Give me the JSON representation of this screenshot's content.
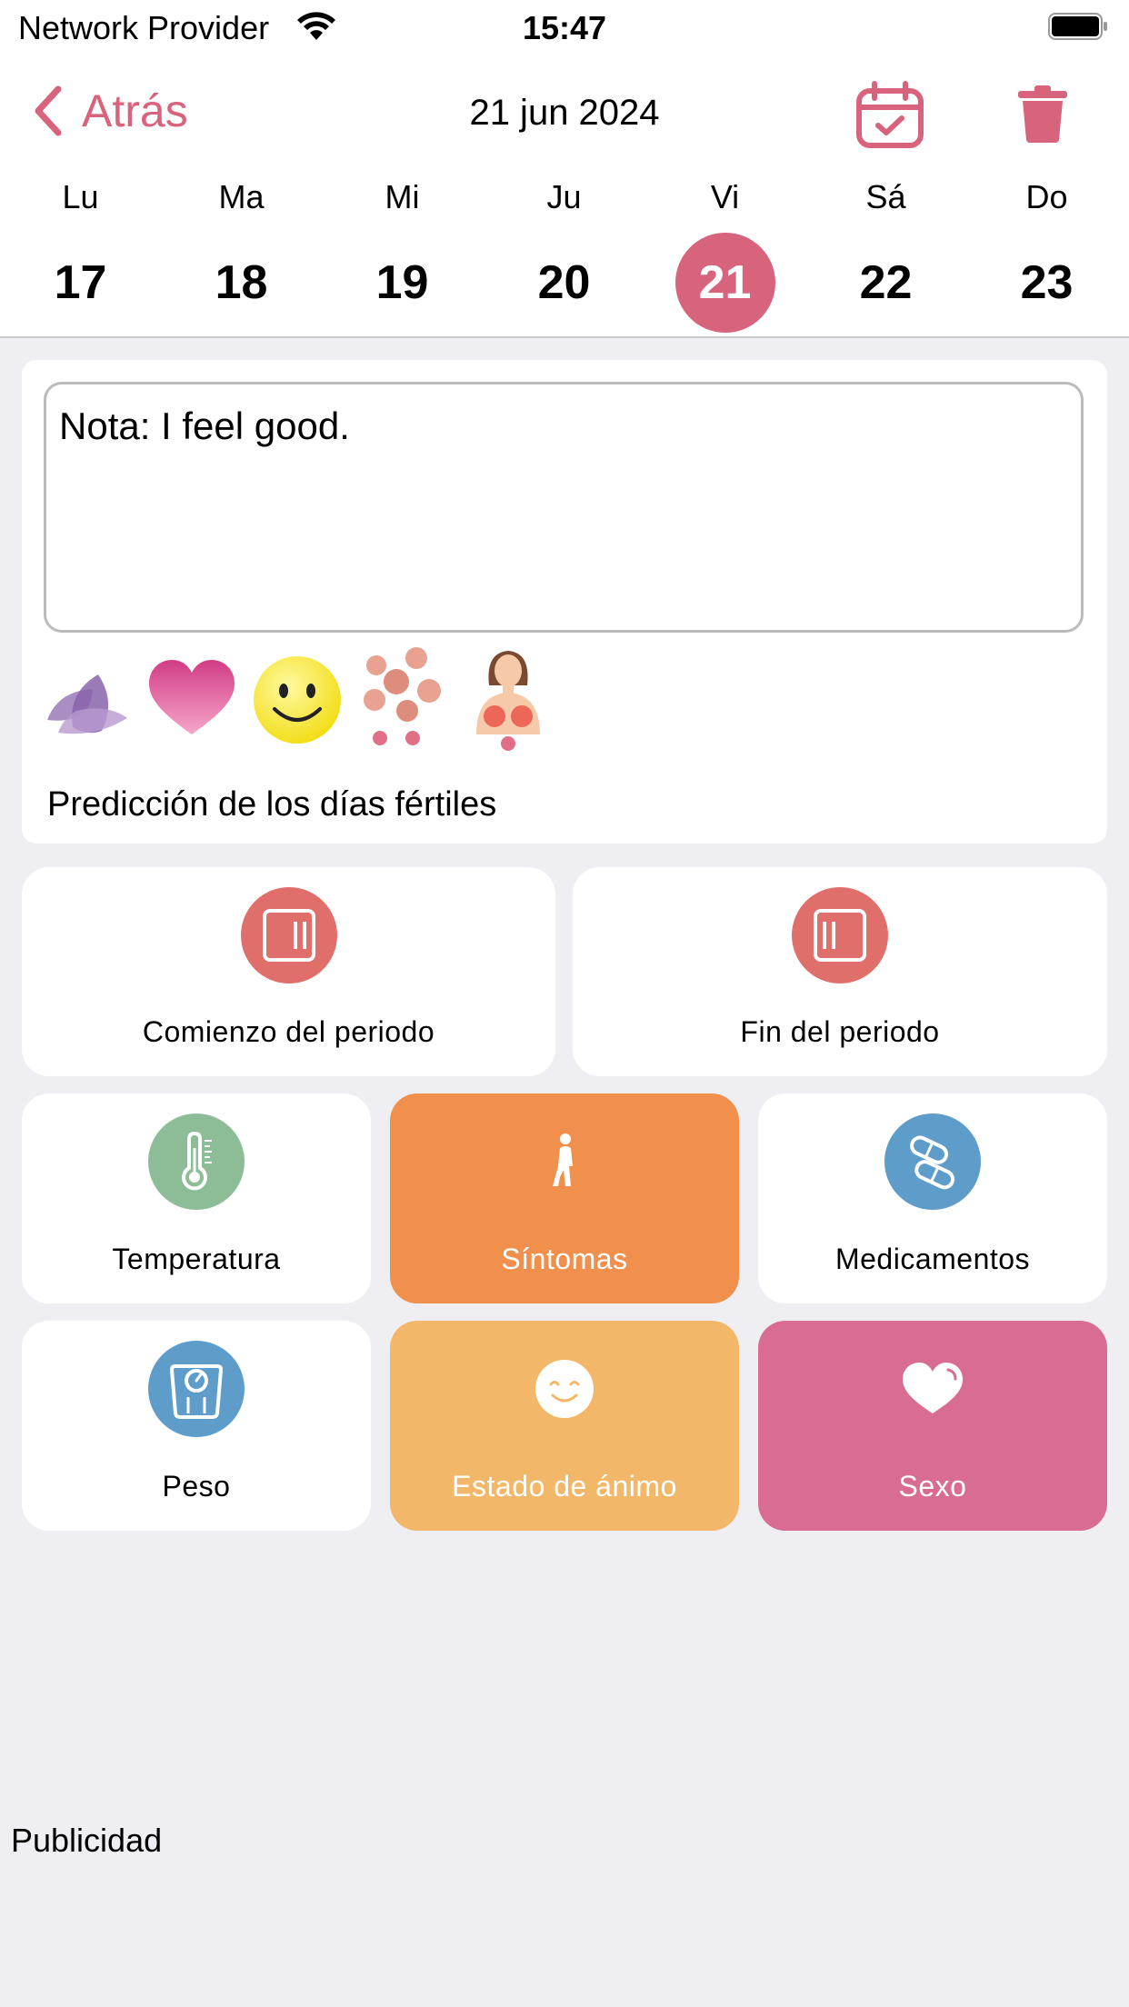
{
  "status_bar": {
    "carrier": "Network Provider",
    "time": "15:47"
  },
  "header": {
    "back_label": "Atrás",
    "date": "21 jun 2024"
  },
  "week": [
    {
      "name": "Lu",
      "num": "17"
    },
    {
      "name": "Ma",
      "num": "18"
    },
    {
      "name": "Mi",
      "num": "19"
    },
    {
      "name": "Ju",
      "num": "20"
    },
    {
      "name": "Vi",
      "num": "21",
      "selected": true
    },
    {
      "name": "Sá",
      "num": "22"
    },
    {
      "name": "Do",
      "num": "23"
    }
  ],
  "note": {
    "text": "Nota: I feel good."
  },
  "entry_icons": [
    "lotus-icon",
    "heart-icon",
    "smiley-icon",
    "acne-icon",
    "breast-pain-icon"
  ],
  "fertile_prediction": "Predicción de los días fértiles",
  "tiles": {
    "period_start": "Comienzo del periodo",
    "period_end": "Fin del periodo",
    "temperature": "Temperatura",
    "symptoms": "Síntomas",
    "medications": "Medicamentos",
    "weight": "Peso",
    "mood": "Estado de ánimo",
    "sex": "Sexo"
  },
  "ad_label": "Publicidad",
  "colors": {
    "accent": "#d8637d",
    "symptoms_tile": "#f0904c",
    "mood_tile": "#f3b769",
    "sex_tile": "#d96c92",
    "period_circle": "#e06f6b",
    "temperature_circle": "#8dbd97",
    "medications_circle": "#5e9cc9"
  }
}
